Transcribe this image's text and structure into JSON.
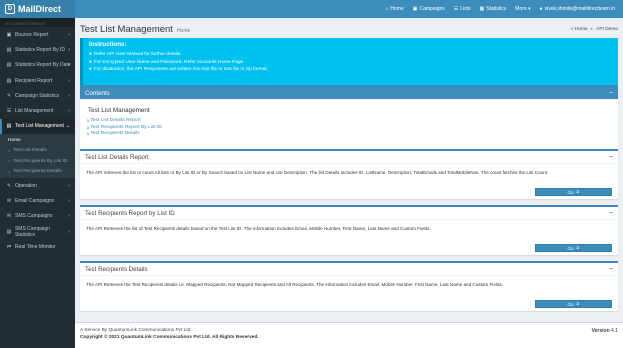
{
  "brand": {
    "logo_mark": "D",
    "name": "MailDirect"
  },
  "topnav": [
    {
      "icon": "⌂",
      "label": "Home"
    },
    {
      "icon": "▣",
      "label": "Campaigns"
    },
    {
      "icon": "☰",
      "label": "Lists"
    },
    {
      "icon": "▦",
      "label": "Statistics"
    },
    {
      "icon": "",
      "label": "More ▾"
    },
    {
      "icon": "●",
      "label": "vivek.shinde@maildirectteam.in"
    }
  ],
  "sidebar": {
    "header": "MYLIBERATIONSANS",
    "items_top": [
      {
        "icon": "▣",
        "label": "Bounce Report"
      },
      {
        "icon": "▤",
        "label": "Statistics Report By ID"
      },
      {
        "icon": "▤",
        "label": "Statistics Report By Date"
      },
      {
        "icon": "▤",
        "label": "Recipient Report"
      },
      {
        "icon": "✎",
        "label": "Campaign Statistics"
      },
      {
        "icon": "☰",
        "label": "List Management"
      }
    ],
    "active": {
      "icon": "▤",
      "label": "Test List Management"
    },
    "sub_items": [
      {
        "label": "Home"
      },
      {
        "label": "Test List Details"
      },
      {
        "label": "Test Recipients By List ID"
      },
      {
        "label": "Test Recipients Details"
      }
    ],
    "items_bottom": [
      {
        "icon": "✎",
        "label": "Operation"
      },
      {
        "icon": "✉",
        "label": "Email Campaigns"
      },
      {
        "icon": "✉",
        "label": "SMS Campaigns"
      },
      {
        "icon": "▤",
        "label": "SMS Campaign Statistics"
      },
      {
        "icon": "⇄",
        "label": "Real Time Monitor"
      }
    ],
    "chevron": "‹"
  },
  "page": {
    "title": "Test List Management",
    "subtitle": "Home",
    "breadcrumb": [
      {
        "icon": "⌂",
        "label": "Home"
      },
      {
        "icon": "▸",
        "label": "API Demo"
      }
    ]
  },
  "instructions": {
    "title": "Instructions:",
    "icon": "●",
    "items": [
      "Refer API User Manual for further details.",
      "For Encrypted User Name and Password, Refer Accounts Home Page.",
      "For Illustration, the API Responses are written into text file or text file in zip format."
    ]
  },
  "contents": {
    "header": "Contents",
    "toggle": "−",
    "title": "Test List Management",
    "links": [
      "Test List Details Report",
      "Test Recipients Report By List ID",
      "Test Recipients Details"
    ]
  },
  "sections": [
    {
      "title": "Test List Details Report",
      "toggle": "−",
      "body": "The API retrieves the list or count All lists or By List ID or By Search based on List Name and List Description. The list Details includes ID, ListName, Description, TotalEmails and TotalMobileNos. The count fetches the List Count",
      "button": "Go"
    },
    {
      "title": "Test Recipients Report by List ID",
      "toggle": "−",
      "body": "The API Retrieves the list of Test Recipients details based on the Test List ID. The information includes Email, Mobile Number, First Name, Last Name and Custom Fields.",
      "button": "Go"
    },
    {
      "title": "Test Recipients Details",
      "toggle": "−",
      "body": "The API Retrieves the Test Recipients details i.e. Mapped Recipients, Not Mapped Recipients and All Recipients. The information includes Email, Mobile Number, First Name, Last Name and Custom Fields.",
      "button": "Go"
    }
  ],
  "footer": {
    "line1": "A Service By QuantumLink Communications Pvt Ltd",
    "line2": "Copyright © 2021 QuantumLink Communications Pvt Ltd. All Rights Reserved.",
    "version_label": "Version",
    "version": "4.1"
  },
  "colors": {
    "header_dark": "#367fa9",
    "header": "#3c8dbc",
    "sidebar": "#222d32",
    "callout": "#00c0ef",
    "page_bg": "#ecf0f5"
  }
}
